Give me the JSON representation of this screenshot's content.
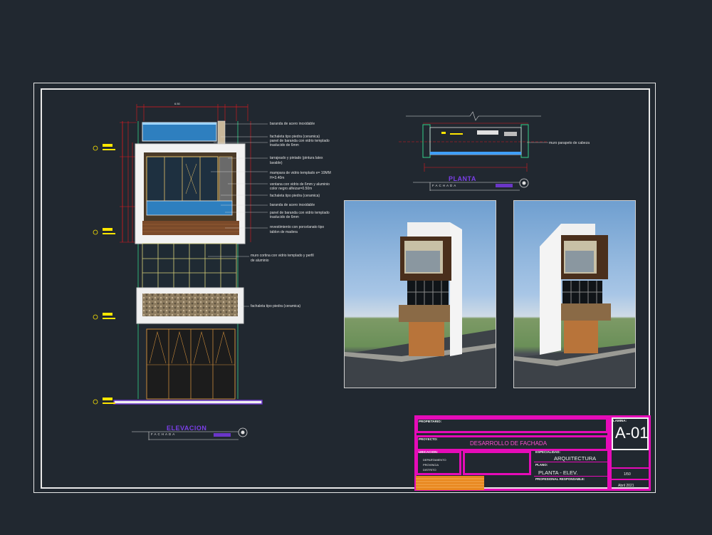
{
  "elevation": {
    "title": "ELEVACION",
    "subtitle": "FACHADA",
    "dim_top_total": "6.50",
    "notes": [
      "baranda de acero inoxidable",
      "fachaleta tipo piedra (ceramica)",
      "panel de baranda con vidrio templado",
      "traslucido de 6mm",
      "tarrajeado y pintado (pintura latex",
      "lavable)",
      "mampara de vidrio templado e= 10MM",
      "H=3.40m",
      "ventana con vidrio de 6mm y aluminio",
      "color negro alfeizar=0.50m",
      "fachaleta tipo piedra (ceramica)",
      "baranda de acero inoxidable",
      "panel de baranda con vidrio templado",
      "traslucido de 6mm",
      "revestimiento con porcelanato tipo",
      "tablon de madera",
      "muro cortina con vidrio templado y perfil",
      "de aluminio",
      "fachaleta tipo piedra (ceramica)"
    ]
  },
  "plan": {
    "title": "PLANTA",
    "subtitle": "FACHADA",
    "note": "muro parapeto de cabeza"
  },
  "title_block": {
    "owner_label": "PROPIETARIO:",
    "project_label": "PROYECTO:",
    "project_value": "DESARROLLO DE FACHADA",
    "location_label": "UBICACION:",
    "location_rows": [
      "DEPARTAMENTO",
      "PROVINCIA",
      "DISTRITO"
    ],
    "specialty_label": "ESPECIALIDAD:",
    "specialty_value": "ARQUITECTURA",
    "plan_label": "PLANO:",
    "plan_value": "PLANTA - ELEV.",
    "professional_label": "PROFESIONAL RESPONSABLE:",
    "sheet_label": "LAMINA:",
    "sheet_code": "A-01",
    "scale": "1/50",
    "date": "Abril 2021"
  },
  "colors": {
    "background": "#212830",
    "title_block_border": "#e60bb8",
    "view_title": "#7b3fe8",
    "dimension_red": "#e0191f",
    "level_marker": "#ffe600"
  }
}
